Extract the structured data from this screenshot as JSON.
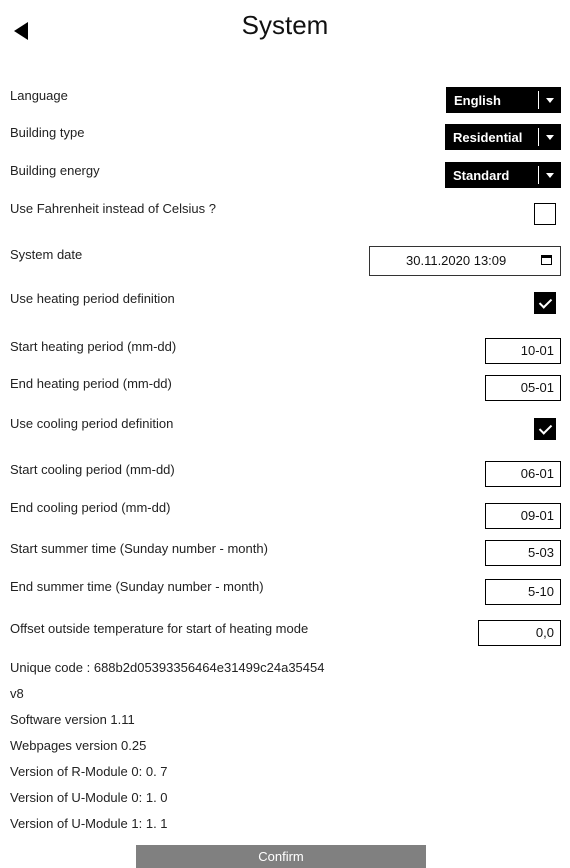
{
  "header": {
    "title": "System",
    "back_icon": "back-arrow-icon"
  },
  "settings": {
    "language": {
      "label": "Language",
      "value": "English"
    },
    "building_type": {
      "label": "Building type",
      "value": "Residential"
    },
    "building_energy": {
      "label": "Building energy",
      "value": "Standard"
    },
    "fahrenheit": {
      "label": "Use Fahrenheit instead of Celsius ?",
      "checked": false
    },
    "system_date": {
      "label": "System date",
      "value": "30.11.2020 13:09",
      "icon": "calendar-icon"
    },
    "use_heating_period": {
      "label": "Use heating period definition",
      "checked": true
    },
    "start_heating": {
      "label": "Start heating period (mm-dd)",
      "value": "10-01"
    },
    "end_heating": {
      "label": "End heating period (mm-dd)",
      "value": "05-01"
    },
    "use_cooling_period": {
      "label": "Use cooling period definition",
      "checked": true
    },
    "start_cooling": {
      "label": "Start cooling period (mm-dd)",
      "value": "06-01"
    },
    "end_cooling": {
      "label": "End cooling period (mm-dd)",
      "value": "09-01"
    },
    "start_summer": {
      "label": "Start summer time (Sunday number - month)",
      "value": "5-03"
    },
    "end_summer": {
      "label": "End summer time (Sunday number - month)",
      "value": "5-10"
    },
    "offset_outside": {
      "label": "Offset outside temperature for start of heating mode",
      "value": "0,0"
    }
  },
  "info": {
    "unique_code": "Unique code : 688b2d05393356464e31499c24a35454",
    "v": "v8",
    "software": "Software version 1.11",
    "webpages": "Webpages version 0.25",
    "r_module_0": "Version of R-Module 0: 0. 7",
    "u_module_0": "Version of U-Module 0: 1. 0",
    "u_module_1": "Version of U-Module 1: 1. 1"
  },
  "actions": {
    "confirm_label": "Confirm"
  },
  "colors": {
    "select_bg": "#000000",
    "confirm_bg": "#808080",
    "text": "#222222"
  }
}
